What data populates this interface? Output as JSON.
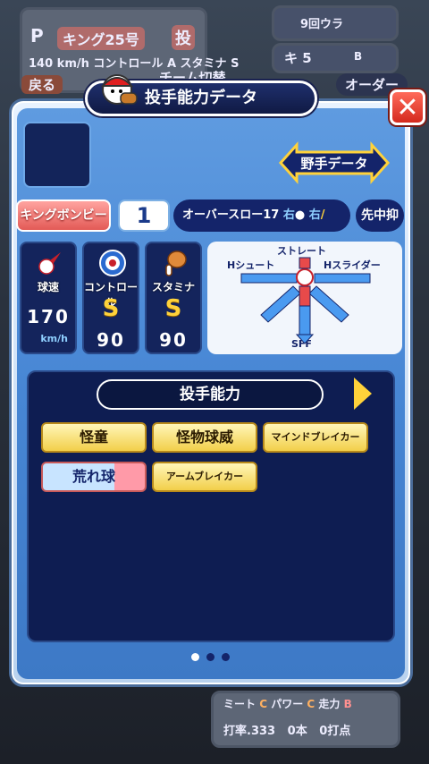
{
  "background": {
    "pitcher_badge": "P",
    "pitcher_name": "キング25号",
    "position_short": "投",
    "speed": "140",
    "speed_unit": "km/h",
    "control_label": "コントロール",
    "control_rank": "A",
    "stamina_label": "スタミナ",
    "stamina_rank": "S",
    "back_label": "戻る",
    "team_switch": "チーム切替",
    "inning": "9回ウラ",
    "strike_label": "キ",
    "strike_count": "5",
    "ball_label": "B",
    "order_label": "オーダー",
    "meet_label": "ミート",
    "meet_rank": "C",
    "power_label": "パワー",
    "power_rank": "C",
    "run_label": "走力",
    "run_rank": "B",
    "avg_label": "打率.333",
    "hr_label": "0本",
    "rbi_label": "0打点"
  },
  "modal": {
    "title": "投手能力データ",
    "fielder_button": "野手データ",
    "player_name": "キングボンビー",
    "number": "1",
    "form": "オーバースロー17",
    "throws": "右",
    "bats": "右",
    "role": "先中抑",
    "stats": [
      {
        "label": "球速",
        "value": "170",
        "unit": "km/h",
        "icon": "baseball-speed-icon"
      },
      {
        "label": "コントロール",
        "grade": "S",
        "value": "90",
        "icon": "target-icon"
      },
      {
        "label": "スタミナ",
        "grade": "S",
        "value": "90",
        "icon": "meat-icon"
      }
    ],
    "pitch_chart": {
      "up": "ストレート",
      "left": "Hシュート",
      "right": "Hスライダー",
      "down": "SFF"
    },
    "ability_title": "投手能力",
    "abilities": [
      "怪童",
      "怪物球威",
      "マインドブレイカー",
      "荒れ球",
      "アームブレイカー"
    ]
  },
  "colors": {
    "accent": "#ffd23a",
    "navy": "#14246a",
    "close": "#d42a1e"
  }
}
